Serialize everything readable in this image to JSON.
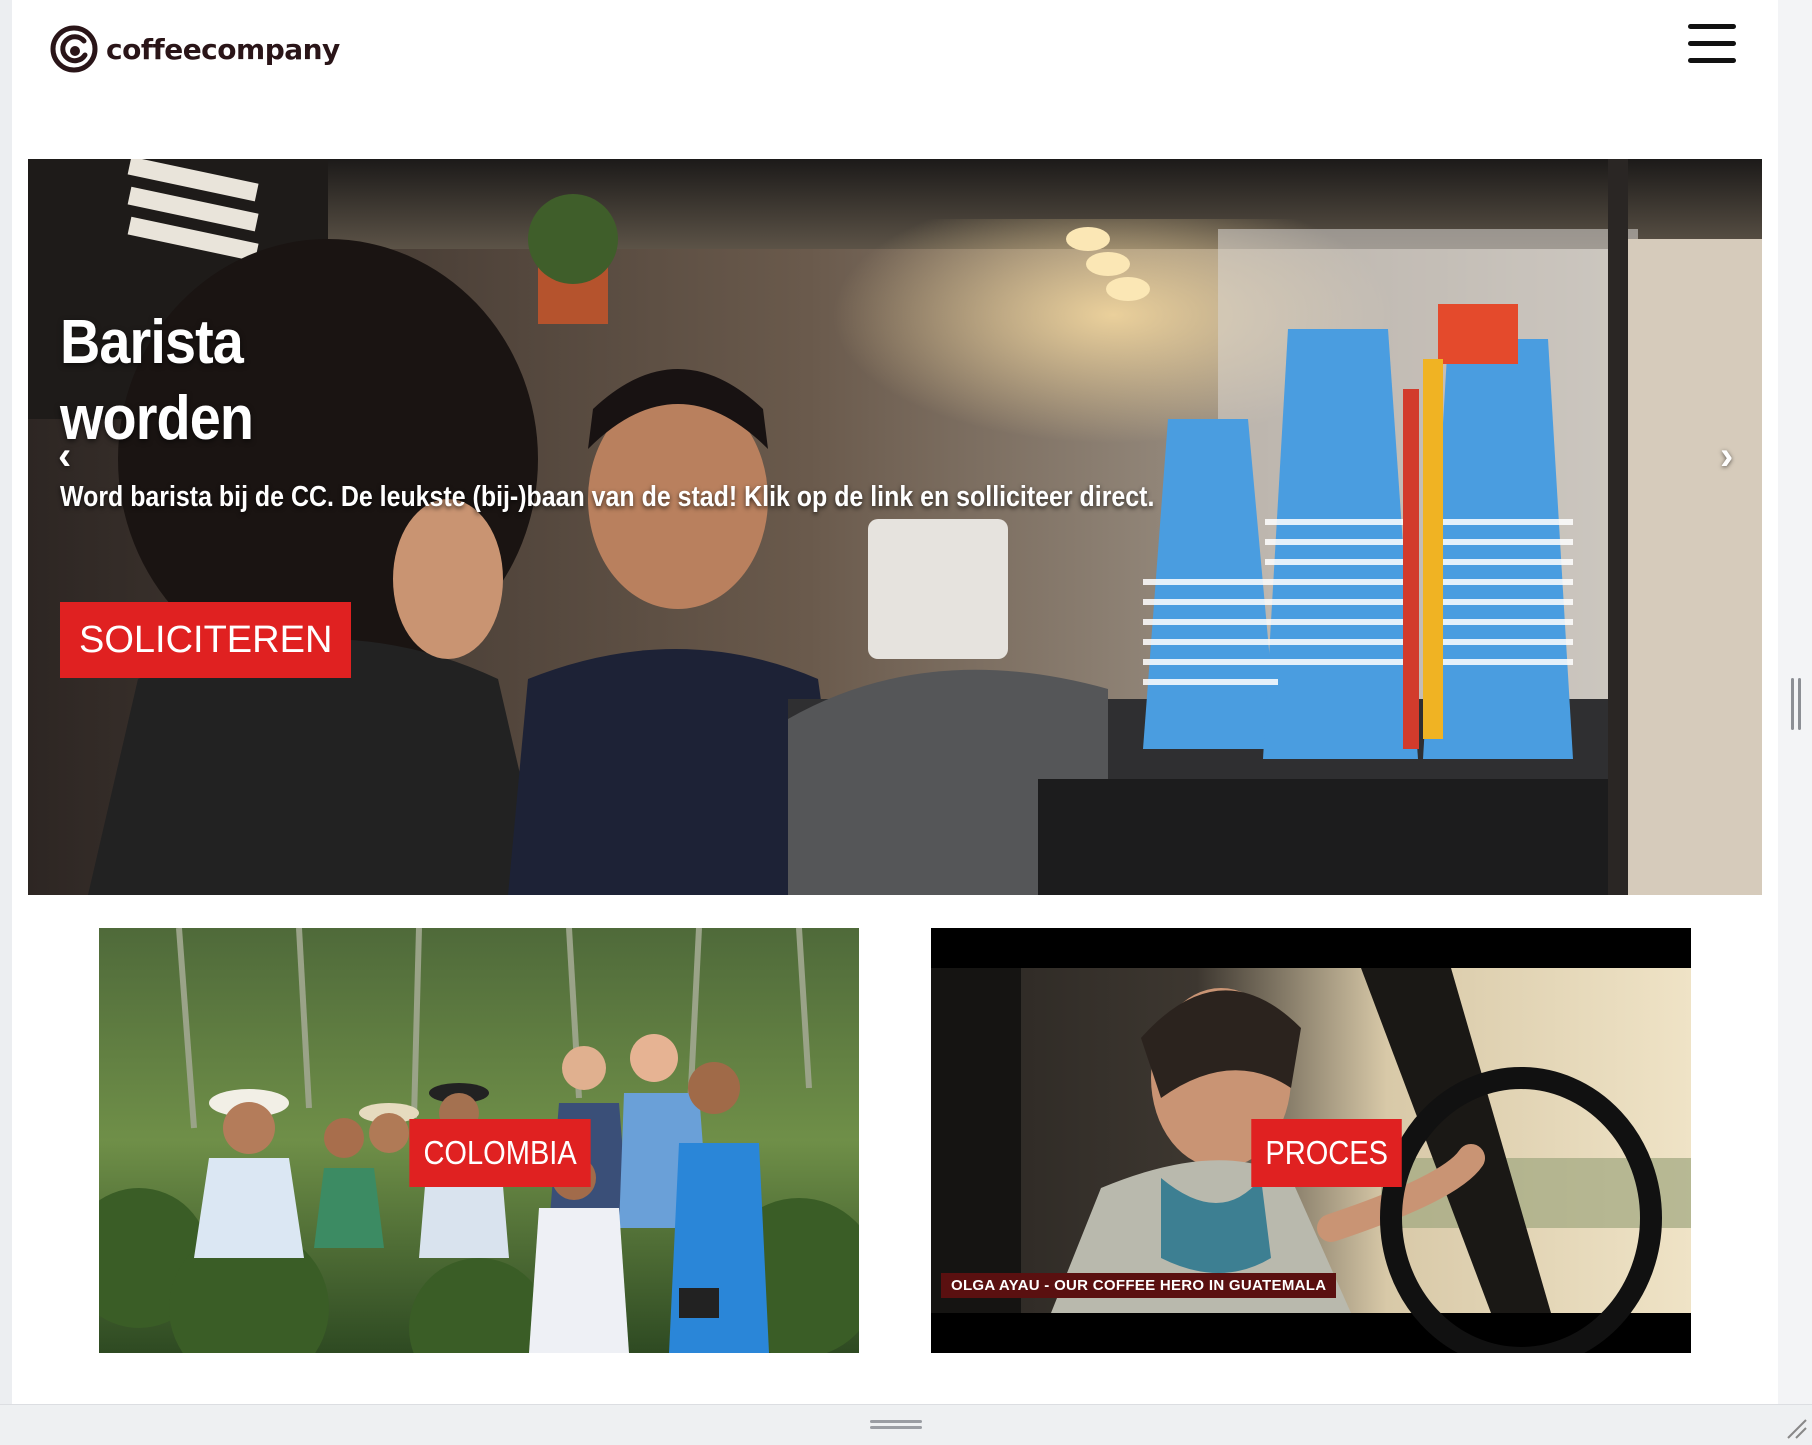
{
  "header": {
    "brand": "coffeecompany",
    "menu_icon": "hamburger-menu-icon"
  },
  "hero": {
    "title": "Barista\nworden",
    "subtitle": "Word barista bij de CC. De leukste (bij-)baan van de stad! Klik op de link en solliciteer direct.",
    "button_label": "SOLICITEREN",
    "prev_arrow": "‹",
    "next_arrow": "›"
  },
  "cards": [
    {
      "label": "COLOMBIA"
    },
    {
      "label": "PROCES",
      "caption": "OLGA AYAU - OUR COFFEE HERO IN GUATEMALA"
    }
  ],
  "colors": {
    "accent": "#e02121",
    "brand_text": "#2a1518"
  }
}
